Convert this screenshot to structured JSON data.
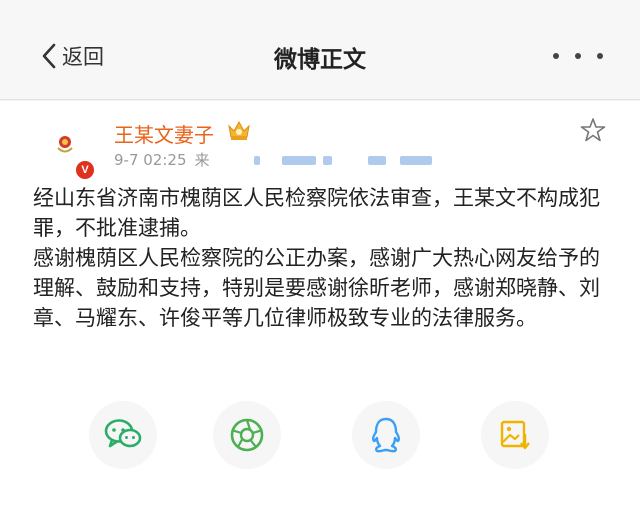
{
  "nav": {
    "back_label": "返回",
    "title": "微博正文"
  },
  "post": {
    "username": "王某文妻子",
    "date": "9-7 02:25",
    "source": "来",
    "paragraphs": [
      "经山东省济南市槐荫区人民检察院依法审查，王某文不构成犯罪，不批准逮捕。",
      "感谢槐荫区人民检察院的公正办案，感谢广大热心网友给予的理解、鼓励和支持，特别是要感谢徐昕老师，感谢郑晓静、刘章、马耀东、许俊平等几位律师极致专业的法律服务。"
    ]
  },
  "colors": {
    "username": "#e8641b",
    "wechat": "#2aae67",
    "moments": "#4caf50",
    "qq": "#3b9ff5",
    "save_image": "#f0b400",
    "verified_badge": "#e0301e"
  },
  "share": {
    "icons": [
      "wechat-icon",
      "moments-icon",
      "qq-icon",
      "save-image-icon"
    ]
  }
}
